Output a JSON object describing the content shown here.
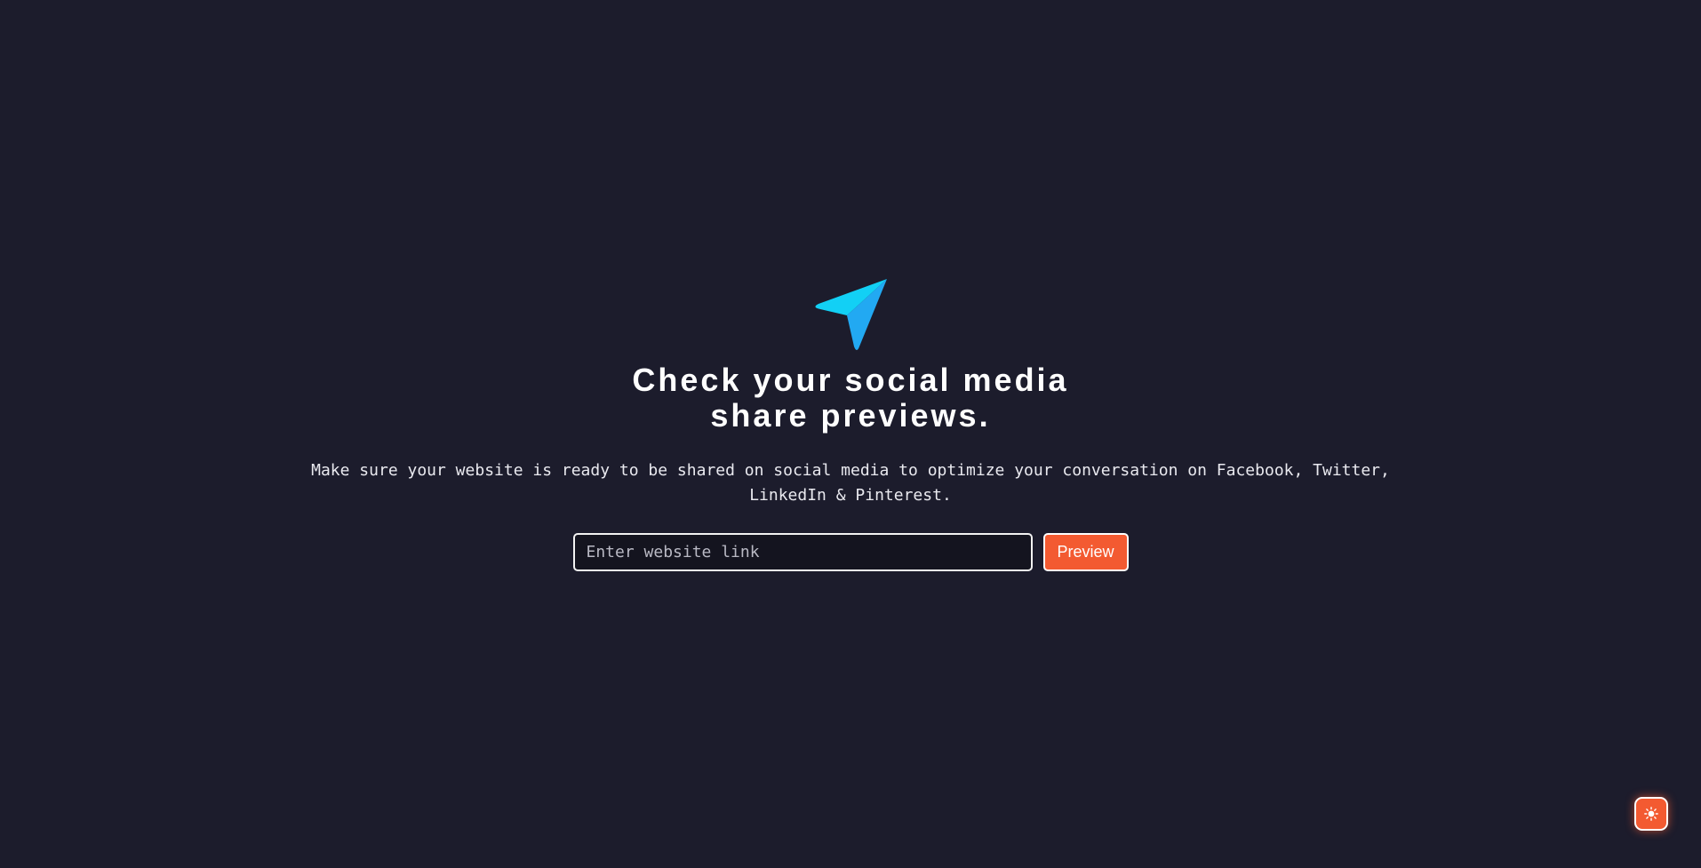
{
  "hero": {
    "logo_icon": "paper-plane-icon",
    "headline_line1": "Check your social media",
    "headline_line2": "share previews.",
    "subtitle": "Make sure your website is ready to be shared on social media to optimize your conversation on Facebook, Twitter, LinkedIn & Pinterest."
  },
  "form": {
    "url_placeholder": "Enter website link",
    "url_value": "",
    "preview_label": "Preview"
  },
  "theme_toggle": {
    "icon": "sun-icon"
  },
  "colors": {
    "background": "#1c1c2c",
    "accent": "#f35a31",
    "logo_light": "#12d0f5",
    "logo_dark": "#22a9f2"
  }
}
